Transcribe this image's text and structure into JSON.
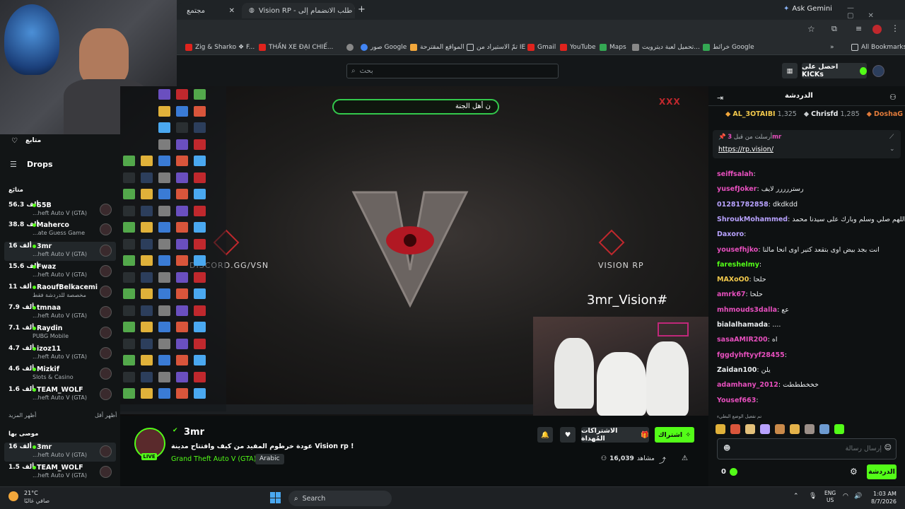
{
  "browser": {
    "tabs": [
      {
        "label": "مجتمع"
      },
      {
        "label": "Vision RP - طلب الانضمام إلى V"
      }
    ],
    "ask_gemini": "Ask Gemini",
    "bookmarks": [
      {
        "label": "Zig & Sharko ❖ F...",
        "color": "#e0231d",
        "icon": "youtube-icon"
      },
      {
        "label": "THẦN XE ĐẠI CHIẾ...",
        "color": "#e0231d",
        "icon": "youtube-icon"
      },
      {
        "label": "",
        "color": "#888888",
        "icon": "globe-icon"
      },
      {
        "label": "صور Google",
        "color": "#4285f4",
        "icon": "google-icon"
      },
      {
        "label": "المواقع المقترحة",
        "color": "#f2a73b",
        "icon": "web-slice-icon"
      },
      {
        "label": "تمّ الاستيراد من IE",
        "color": "#c9cdd0",
        "icon": "folder-icon"
      },
      {
        "label": "Gmail",
        "color": "#e0231d",
        "icon": "gmail-icon"
      },
      {
        "label": "YouTube",
        "color": "#e0231d",
        "icon": "youtube-icon"
      },
      {
        "label": "Maps",
        "color": "#34a853",
        "icon": "maps-icon"
      },
      {
        "label": "تحميل لعبة ديترويت...",
        "color": "#888888",
        "icon": "site-icon"
      },
      {
        "label": "خرائط Google",
        "color": "#34a853",
        "icon": "maps-icon"
      }
    ],
    "all_bookmarks": "All Bookmarks"
  },
  "kick": {
    "search_placeholder": "بحث",
    "get_kicks": "احصل على KICKs"
  },
  "sidebar": {
    "following_label": "متابع",
    "drops_label": "Drops",
    "section_following": "متابَع",
    "channels": [
      {
        "count": "56.3 ألف",
        "name": "S5B",
        "game": "...heft Auto V (GTA)"
      },
      {
        "count": "38.8 ألف",
        "name": "Maherco",
        "game": "...ate Guess Game"
      },
      {
        "count": "16 ألف",
        "name": "3mr",
        "game": "...heft Auto V (GTA)",
        "active": true
      },
      {
        "count": "15.6 ألف",
        "name": "Fwaz",
        "game": "...heft Auto V (GTA)"
      },
      {
        "count": "11 ألف",
        "name": "RaoufBelkacemi",
        "game": "مخصصة للدردشة فقط"
      },
      {
        "count": "7.9 ألف",
        "name": "tmnaa",
        "game": "...heft Auto V (GTA)"
      },
      {
        "count": "7.1 ألف",
        "name": "Raydin",
        "game": "PUBG Mobile"
      },
      {
        "count": "4.7 ألف",
        "name": "izoz11",
        "game": "...heft Auto V (GTA)"
      },
      {
        "count": "4.6 ألف",
        "name": "Mizkif",
        "game": "Slots & Casino"
      },
      {
        "count": "1.6 ألف",
        "name": "TEAM_WOLF",
        "game": "...heft Auto V (GTA)"
      }
    ],
    "show_more": "أظهر المزيد",
    "show_less": "أظهر أقل",
    "recommended_label": "موصى بها",
    "recommended": [
      {
        "count": "16 ألف",
        "name": "3mr",
        "game": "...heft Auto V (GTA)",
        "active": true
      },
      {
        "count": "1.5 ألف",
        "name": "TEAM_WOLF",
        "game": "...heft Auto V (GTA)"
      }
    ]
  },
  "video": {
    "banner_text": "ن أهل الجنة",
    "discord_text": "DISCORD.GG/VSN",
    "vision_text": "VISION RP",
    "handle_text": "3mr_Vision#",
    "xxx_text": "XXX"
  },
  "stream": {
    "streamer": "3mr",
    "title": "عودة خرطوم المفيد من كيف وافتتاح مدينة Vision rp !",
    "category": "Grand Theft Auto V (GTA)",
    "language": "Arabic",
    "viewers": "16,039",
    "viewers_label": "مشاهد",
    "live_badge": "LIVE",
    "follow_label": "اشتراك",
    "gift_label": "الاشتراكات المُهداة"
  },
  "chat": {
    "header": "الدردشة",
    "top_gifters": [
      {
        "name": "AL_3OTAIBI",
        "count": "1,325"
      },
      {
        "name": "Chrisfd",
        "count": "1,285"
      },
      {
        "name": "DoshaG",
        "count": ""
      }
    ],
    "pinned_by": "أرسلت من قبل",
    "pinned_user": "3mr",
    "pinned_link": "https://rp.vision/",
    "messages": [
      {
        "user": "seiffsalah",
        "text": "",
        "color": "#e64fbd"
      },
      {
        "user": "yusefJoker",
        "text": "رستررررر لايف",
        "color": "#e64fbd"
      },
      {
        "user": "01281782858",
        "text": "dkdkdd",
        "color": "#b8a2ff"
      },
      {
        "user": "ShroukMohammed",
        "text": "اللهم صلي وسلم وبارك على سيدنا محمد",
        "color": "#b8a2ff"
      },
      {
        "user": "Daxoro",
        "text": "",
        "color": "#b8a2ff"
      },
      {
        "user": "yousefhjko",
        "text": "انت بجد بيض اوى بتقعد كتير اوى انحا مالنا",
        "color": "#e64fbd"
      },
      {
        "user": "fareshelmy",
        "text": "",
        "color": "#53fc18"
      },
      {
        "user": "MAXoO0",
        "text": "حلحا",
        "color": "#f2c94c"
      },
      {
        "user": "amrk67",
        "text": "حلحا",
        "color": "#e64fbd"
      },
      {
        "user": "mhmouds3dalla",
        "text": "عع",
        "color": "#e64fbd"
      },
      {
        "user": "bialalhamada",
        "text": "....",
        "color": "#e9ecee"
      },
      {
        "user": "sasaAMIR200",
        "text": "اه",
        "color": "#e64fbd"
      },
      {
        "user": "fggdyhftyyf28455",
        "text": "",
        "color": "#e64fbd"
      },
      {
        "user": "Zaidan100",
        "text": "يلن",
        "color": "#e9ecee"
      },
      {
        "user": "adamhany_2012",
        "text": "خخخطططت",
        "color": "#e64fbd"
      },
      {
        "user": "Yousef663",
        "text": "",
        "color": "#e64fbd"
      }
    ],
    "slowmode_notice": "تم تفعيل الوضع البطيء",
    "input_placeholder": "إرسال رسالة",
    "kicks_count": "0",
    "send_label": "الدردشة"
  },
  "taskbar": {
    "weather_temp": "21°C",
    "weather_desc": "صافي غالبًا",
    "search_label": "Search",
    "lang_top": "ENG",
    "lang_bottom": "US",
    "time": "1:03 AM",
    "date": "8/7/2026"
  }
}
